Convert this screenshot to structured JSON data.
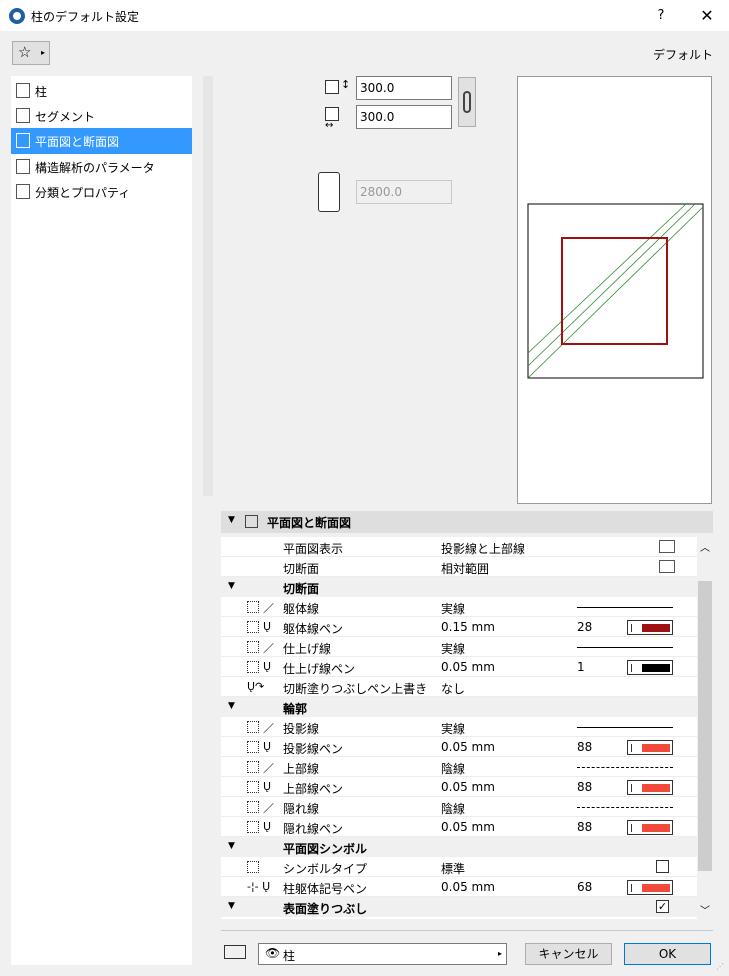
{
  "window": {
    "title": "柱のデフォルト設定",
    "help": "?",
    "close": "✕"
  },
  "favorites": {
    "star": "☆",
    "arrow": "▸"
  },
  "default_label": "デフォルト",
  "nav": [
    {
      "label": "柱",
      "active": false
    },
    {
      "label": "セグメント",
      "active": false
    },
    {
      "label": "平面図と断面図",
      "active": true
    },
    {
      "label": "構造解析のパラメータ",
      "active": false
    },
    {
      "label": "分類とプロパティ",
      "active": false
    }
  ],
  "dimensions": {
    "width": "300.0",
    "depth": "300.0",
    "height": "2800.0"
  },
  "section": {
    "title": "平面図と断面図",
    "toggle": "▼"
  },
  "rows": [
    {
      "name": "平面図表示",
      "value": "投影線と上部線"
    },
    {
      "name": "切断面",
      "value": "相対範囲"
    },
    {
      "group": "切断面"
    },
    {
      "name": "躯体線",
      "value": "実線",
      "line": "solid"
    },
    {
      "name": "躯体線ペン",
      "value": "0.15 mm",
      "num": "28",
      "color": "#a01010"
    },
    {
      "name": "仕上げ線",
      "value": "実線",
      "line": "solid"
    },
    {
      "name": "仕上げ線ペン",
      "value": "0.05 mm",
      "num": "1",
      "color": "#000000"
    },
    {
      "name": "切断塗りつぶしペン上書き",
      "value": "なし"
    },
    {
      "group": "輪郭"
    },
    {
      "name": "投影線",
      "value": "実線",
      "line": "solid"
    },
    {
      "name": "投影線ペン",
      "value": "0.05 mm",
      "num": "88",
      "color": "#f04a3a"
    },
    {
      "name": "上部線",
      "value": "陰線",
      "line": "dash"
    },
    {
      "name": "上部線ペン",
      "value": "0.05 mm",
      "num": "88",
      "color": "#f04a3a"
    },
    {
      "name": "隠れ線",
      "value": "陰線",
      "line": "dash"
    },
    {
      "name": "隠れ線ペン",
      "value": "0.05 mm",
      "num": "88",
      "color": "#f04a3a"
    },
    {
      "group": "平面図シンボル"
    },
    {
      "name": "シンボルタイプ",
      "value": "標準",
      "checkbox": ""
    },
    {
      "name": "柱躯体記号ペン",
      "value": "0.05 mm",
      "num": "68",
      "color": "#f04a3a"
    },
    {
      "group": "表面塗りつぶし",
      "checkbox": "✓"
    }
  ],
  "footer": {
    "layer_value": "柱",
    "eye": "👁",
    "arrow": "▸",
    "cancel": "キャンセル",
    "ok": "OK"
  },
  "colors": {
    "accent": "#3399ff",
    "preview_column": "#a01010",
    "preview_hatch": "#2e8b2e"
  }
}
